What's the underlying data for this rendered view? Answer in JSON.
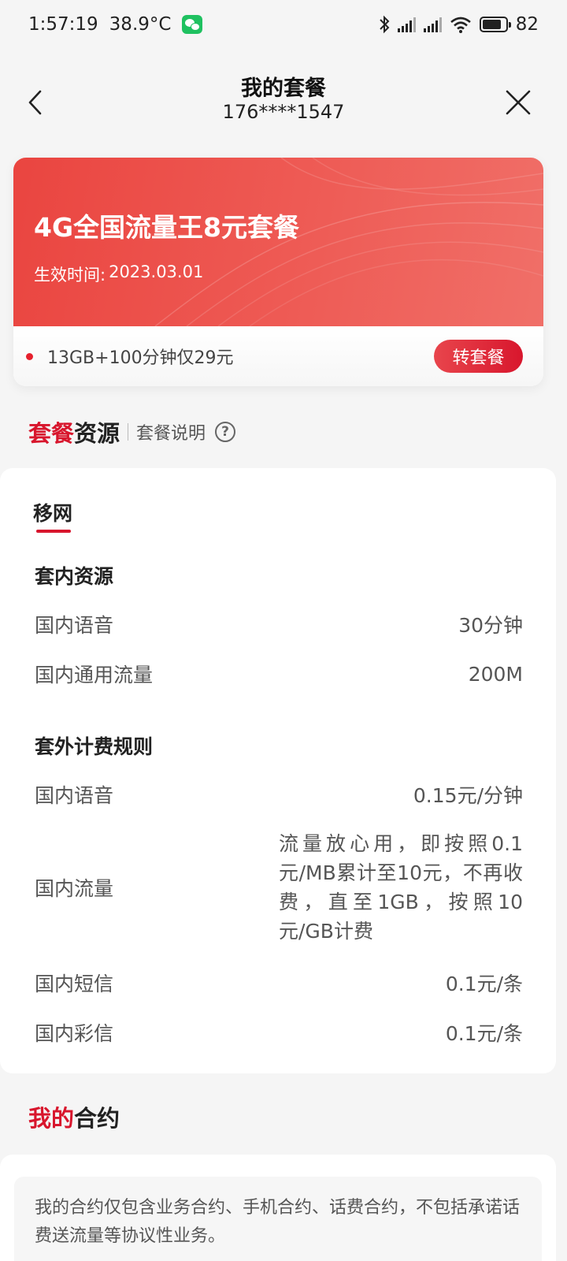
{
  "status_bar": {
    "time": "1:57:19",
    "temperature": "38.9°C",
    "battery": "82",
    "icons": [
      "wechat-icon",
      "bluetooth-icon",
      "signal-icon",
      "signal-icon",
      "wifi-icon",
      "battery-icon"
    ]
  },
  "nav": {
    "title": "我的套餐",
    "phone": "176****1547",
    "back_icon": "chevron-left-icon",
    "close_icon": "close-icon"
  },
  "plan": {
    "name": "4G全国流量王8元套餐",
    "effective_label": "生效时间:",
    "effective_date": "2023.03.01",
    "promo": "13GB+100分钟仅29元",
    "switch_button": "转套餐"
  },
  "resources_section": {
    "title_red": "套餐",
    "title_rest": "资源",
    "link": "套餐说明",
    "help_icon": "?"
  },
  "resources": {
    "tab": "移网",
    "included_title": "套内资源",
    "included": [
      {
        "name": "国内语音",
        "value": "30分钟"
      },
      {
        "name": "国内通用流量",
        "value": "200M"
      }
    ],
    "overage_title": "套外计费规则",
    "overage": [
      {
        "name": "国内语音",
        "value": "0.15元/分钟"
      },
      {
        "name": "国内流量",
        "value": "流量放心用，即按照0.1元/MB累计至10元，不再收费，直至1GB，按照10元/GB计费"
      },
      {
        "name": "国内短信",
        "value": "0.1元/条"
      },
      {
        "name": "国内彩信",
        "value": "0.1元/条"
      }
    ]
  },
  "contract": {
    "title_red": "我的",
    "title_rest": "合约",
    "note": "我的合约仅包含业务合约、手机合约、话费合约，不包括承诺话费送流量等协议性业务。"
  },
  "colors": {
    "accent": "#d8162d",
    "card_red": "#ea4540",
    "background": "#f5f5f5"
  }
}
